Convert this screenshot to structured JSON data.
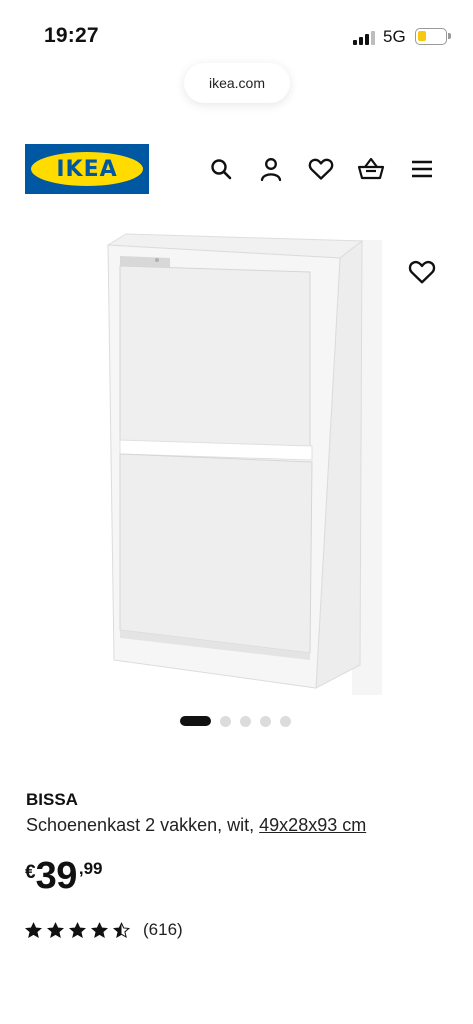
{
  "status_bar": {
    "time": "19:27",
    "network": "5G",
    "battery_level_fraction": 0.3,
    "battery_color": "#f6c90e"
  },
  "browser": {
    "url": "ikea.com"
  },
  "header": {
    "logo_text": "IKEA",
    "brand_blue": "#0058a3",
    "brand_yellow": "#ffdb00",
    "icons": [
      "search-icon",
      "user-icon",
      "heart-icon",
      "basket-icon",
      "menu-icon"
    ]
  },
  "gallery": {
    "image_count": 5,
    "active_index": 0,
    "favorite_icon": "heart-icon"
  },
  "product": {
    "name": "BISSA",
    "description": "Schoenenkast 2 vakken, wit,",
    "dimensions_link": "49x28x93 cm",
    "price": {
      "currency": "€",
      "integer": "39",
      "decimal": ",99"
    },
    "rating": {
      "value": 4.5,
      "max": 5,
      "count_label": "(616)"
    }
  }
}
